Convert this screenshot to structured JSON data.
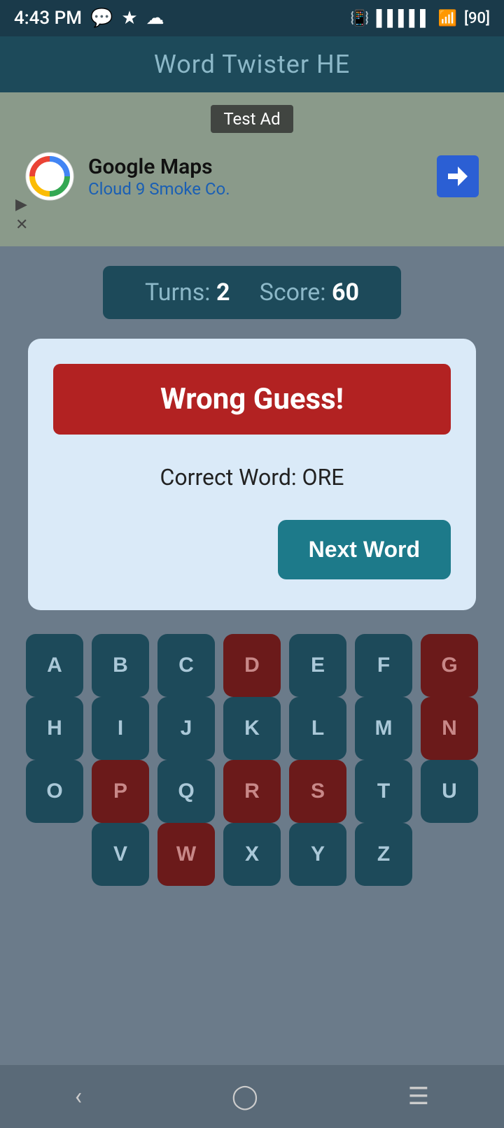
{
  "status": {
    "time": "4:43 PM",
    "battery": "90"
  },
  "header": {
    "title": "Word Twister HE"
  },
  "ad": {
    "label": "Test Ad",
    "company": "Google Maps",
    "subtitle": "Cloud 9 Smoke Co."
  },
  "scorebar": {
    "turns_label": "Turns:",
    "turns_value": "2",
    "score_label": "Score:",
    "score_value": "60"
  },
  "dialog": {
    "wrong_guess": "Wrong Guess!",
    "correct_word_prefix": "Correct Word: ORE",
    "next_word_btn": "Next Word"
  },
  "keyboard": {
    "rows": [
      [
        {
          "letter": "A",
          "used": false
        },
        {
          "letter": "B",
          "used": false
        },
        {
          "letter": "C",
          "used": false
        },
        {
          "letter": "D",
          "used": true
        },
        {
          "letter": "E",
          "used": false
        },
        {
          "letter": "F",
          "used": false
        },
        {
          "letter": "G",
          "used": true
        }
      ],
      [
        {
          "letter": "H",
          "used": false
        },
        {
          "letter": "I",
          "used": false
        },
        {
          "letter": "J",
          "used": false
        },
        {
          "letter": "K",
          "used": false
        },
        {
          "letter": "L",
          "used": false
        },
        {
          "letter": "M",
          "used": false
        },
        {
          "letter": "N",
          "used": true
        }
      ],
      [
        {
          "letter": "O",
          "used": false
        },
        {
          "letter": "P",
          "used": true
        },
        {
          "letter": "Q",
          "used": false
        },
        {
          "letter": "R",
          "used": true
        },
        {
          "letter": "S",
          "used": true
        },
        {
          "letter": "T",
          "used": false
        },
        {
          "letter": "U",
          "used": false
        }
      ],
      [
        {
          "letter": "V",
          "used": false
        },
        {
          "letter": "W",
          "used": true
        },
        {
          "letter": "X",
          "used": false
        },
        {
          "letter": "Y",
          "used": false
        },
        {
          "letter": "Z",
          "used": false
        }
      ]
    ]
  }
}
